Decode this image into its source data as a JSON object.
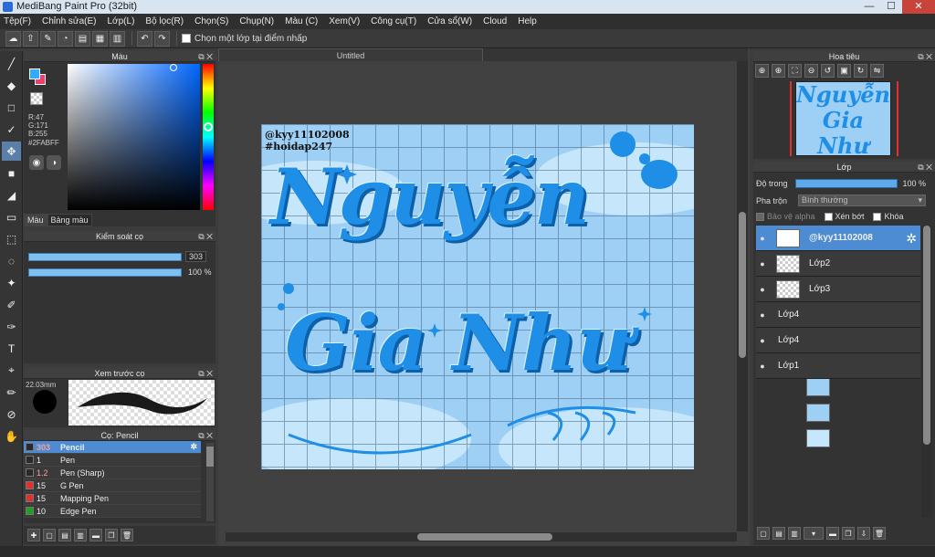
{
  "window": {
    "title": "MediBang Paint Pro (32bit)",
    "minimize": "—",
    "maximize": "☐",
    "close": "✕"
  },
  "menu": [
    "Tệp(F)",
    "Chỉnh sửa(E)",
    "Lớp(L)",
    "Bộ lọc(R)",
    "Chọn(S)",
    "Chụp(N)",
    "Màu (C)",
    "Xem(V)",
    "Công cụ(T)",
    "Cửa sổ(W)",
    "Cloud",
    "Help"
  ],
  "toolbar": {
    "select_from_layer_label": "Chọn một lớp tại điểm nhấp"
  },
  "color_panel": {
    "title": "Màu",
    "r": "R:47",
    "g": "G:171",
    "b": "B:255",
    "hex": "#2FABFF",
    "fg_color": "#2FABFF",
    "tabs": [
      "Màu",
      "Bảng màu"
    ]
  },
  "brush_control": {
    "title": "Kiểm soát cọ",
    "size": "303",
    "opacity": "100 %"
  },
  "brush_preview": {
    "title": "Xem trước cọ",
    "size_label": "22.03mm"
  },
  "brush_list": {
    "title": "Cọ: Pencil",
    "items": [
      {
        "size": "303",
        "name": "Pencil",
        "color": "#2a2a2a"
      },
      {
        "size": "1",
        "name": "Pen",
        "color": "#2a2a2a"
      },
      {
        "size": "1.2",
        "name": "Pen (Sharp)",
        "color": "#2a2a2a"
      },
      {
        "size": "15",
        "name": "G Pen",
        "color": "#e03030"
      },
      {
        "size": "15",
        "name": "Mapping Pen",
        "color": "#e03030"
      },
      {
        "size": "10",
        "name": "Edge Pen",
        "color": "#20a020"
      }
    ]
  },
  "canvas": {
    "tab_title": "Untitled",
    "watermark_line1": "@kyy11102008",
    "watermark_line2": "#hoidap247",
    "text_line1": "Nguyễn",
    "text_line2": "Gia Như"
  },
  "navigator": {
    "title": "Hoa tiêu",
    "thumb_line1": "Nguyễn",
    "thumb_line2": "Gia Như"
  },
  "layer_panel": {
    "title": "Lớp",
    "opacity_label": "Độ trong",
    "opacity_value": "100 %",
    "blend_label": "Pha trộn",
    "blend_value": "Bình thường",
    "protect_alpha": "Bảo vệ alpha",
    "clipping": "Xén bớt",
    "lock": "Khóa",
    "layers": [
      {
        "name": "@kyy11102008"
      },
      {
        "name": "Lớp2"
      },
      {
        "name": "Lớp3"
      },
      {
        "name": "Lớp4"
      },
      {
        "name": "Lớp4"
      },
      {
        "name": "Lớp1"
      }
    ]
  }
}
